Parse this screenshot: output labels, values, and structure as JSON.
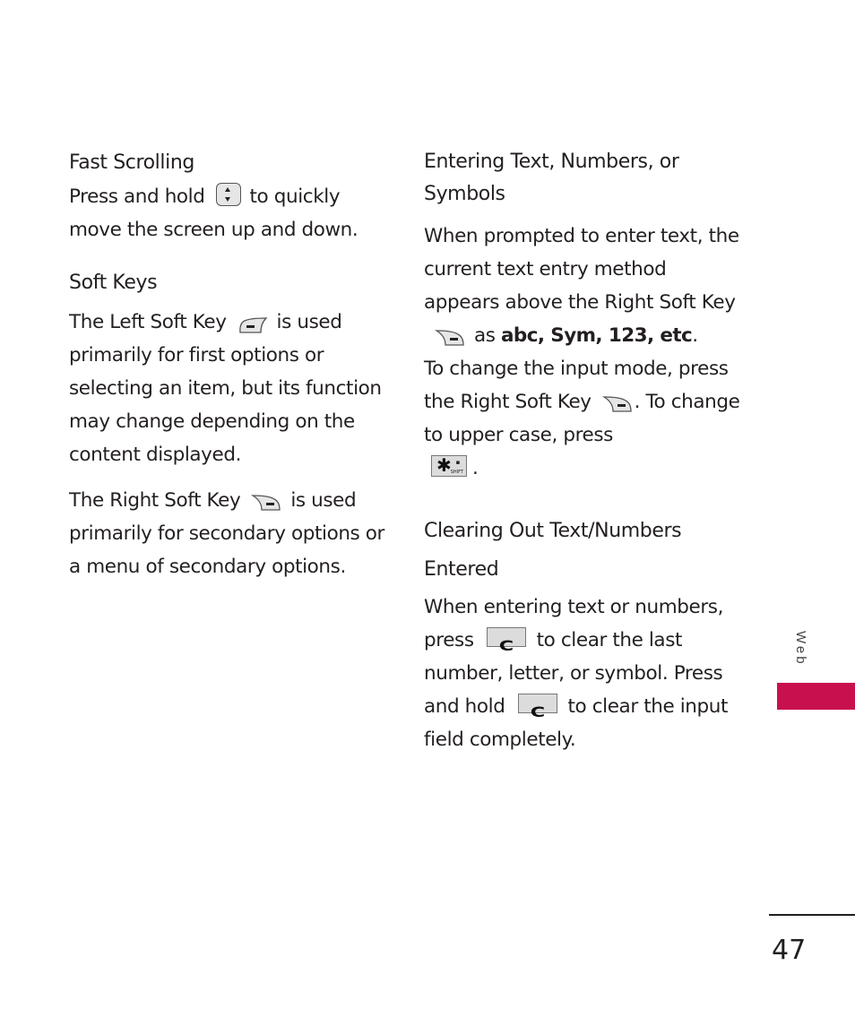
{
  "left_column": {
    "fast_scrolling": {
      "heading": "Fast Scrolling",
      "text_before_icon": "Press and hold",
      "icon": "up-down-navigation-key-icon",
      "text_after_icon": "to quickly move the screen up and down."
    },
    "soft_keys": {
      "heading": "Soft Keys",
      "left_key_before": "The Left Soft Key",
      "left_key_icon": "left-soft-key-icon",
      "left_key_after": "is used primarily for first options or selecting an item, but its function may change depending on the content displayed.",
      "right_key_before": "The Right Soft Key",
      "right_key_icon": "right-soft-key-icon",
      "right_key_after": "is used primarily for secondary options or a menu of secondary options."
    }
  },
  "right_column": {
    "entering_text": {
      "heading": "Entering Text, Numbers, or Symbols",
      "p1_before": "When prompted to enter text, the current text entry method appears above the Right Soft Key",
      "p1_icon": "right-soft-key-icon",
      "p1_mid": "as",
      "p1_bold": "abc, Sym, 123, etc",
      "p1_end": ".",
      "p2_before": "To change the input mode, press the Right Soft Key",
      "p2_icon": "right-soft-key-icon",
      "p2_after": ". To change to upper case, press",
      "p2_key_icon": "star-shift-key-icon",
      "p2_key_symbol": "✱",
      "p2_key_sublabel": "SHIFT",
      "p2_end": "."
    },
    "clearing_text": {
      "heading": "Clearing Out Text/Numbers Entered",
      "p_before": "When entering text or numbers, press",
      "clear_key_label": "C",
      "p_mid": "to clear the last number, letter, or symbol. Press and hold",
      "p_end": "to clear the input field completely."
    }
  },
  "sidebar": {
    "section_label": "Web",
    "tab_color": "#c8104f"
  },
  "footer": {
    "page_number": "47"
  }
}
